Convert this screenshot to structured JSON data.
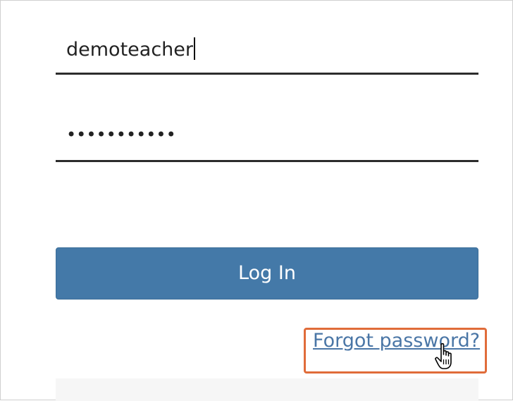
{
  "login_form": {
    "username_value": "demoteacher",
    "password_masked": "•••••••••••",
    "login_button_label": "Log In",
    "forgot_password_label": "Forgot password?"
  },
  "colors": {
    "button_bg": "#4479a8",
    "link": "#4a76a6",
    "highlight": "#e06c3a"
  },
  "icons": {
    "cursor": "hand-pointer-icon"
  }
}
